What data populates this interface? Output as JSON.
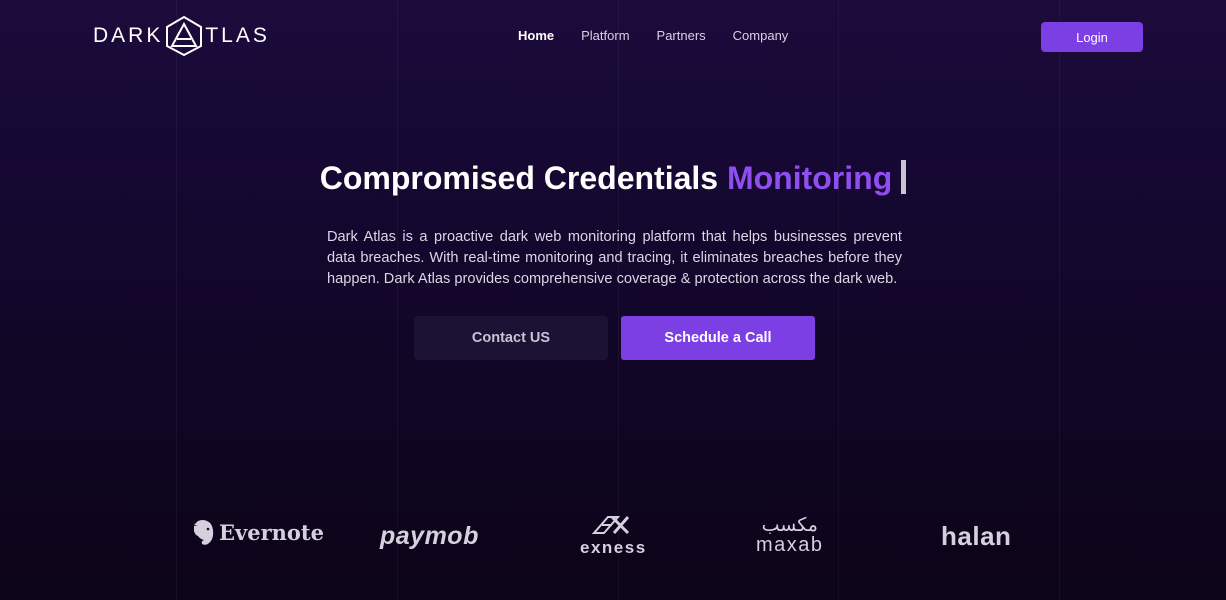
{
  "header": {
    "logo_left": "DARK",
    "logo_right": "TLAS",
    "nav": [
      {
        "label": "Home",
        "active": true
      },
      {
        "label": "Platform",
        "active": false
      },
      {
        "label": "Partners",
        "active": false
      },
      {
        "label": "Company",
        "active": false
      }
    ],
    "login_label": "Login"
  },
  "hero": {
    "title_main": "Compromised Credentials",
    "title_accent": "Monitoring",
    "description": "Dark Atlas is a proactive dark web monitoring platform that helps businesses prevent data breaches. With real-time monitoring and tracing, it eliminates breaches before they happen. Dark Atlas provides comprehensive coverage & protection across the dark web.",
    "contact_label": "Contact US",
    "call_label": "Schedule a Call"
  },
  "partners": {
    "evernote": "Evernote",
    "paymob": "paymob",
    "exness": "exness",
    "maxab_arabic": "مكسب",
    "maxab_latin": "maxab",
    "halan": "halan"
  },
  "colors": {
    "accent": "#7b3fe4",
    "accent_text": "#8f4ef0",
    "background": "#140731"
  },
  "icons": [
    "atlas-logo-icon",
    "evernote-elephant-icon",
    "exness-mark-icon",
    "typing-cursor-icon"
  ]
}
